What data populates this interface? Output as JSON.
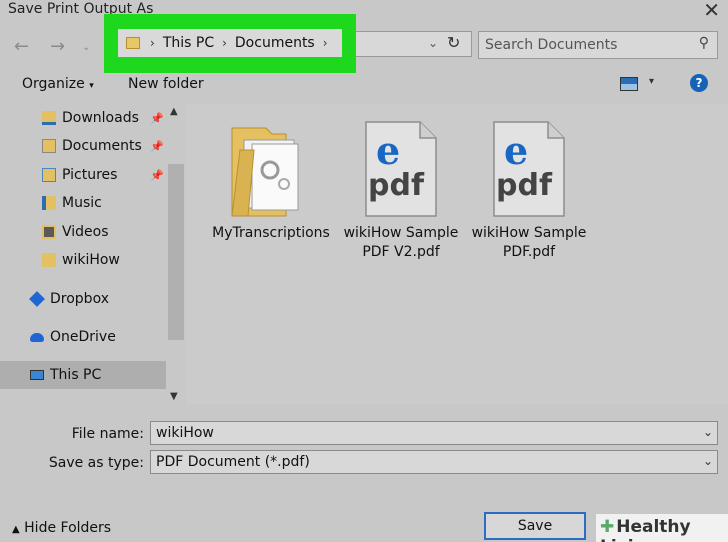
{
  "window": {
    "title": "Save Print Output As",
    "close_icon": "close-icon"
  },
  "nav": {
    "back_icon": "arrow-left-icon",
    "forward_icon": "arrow-right-icon",
    "breadcrumb": [
      "This PC",
      "Documents"
    ],
    "refresh_icon": "refresh-icon",
    "search_placeholder": "Search Documents"
  },
  "toolbar": {
    "organize_label": "Organize",
    "new_folder_label": "New folder",
    "help_label": "?"
  },
  "sidebar": {
    "items": [
      {
        "label": "Downloads",
        "pinned": true
      },
      {
        "label": "Documents",
        "pinned": true
      },
      {
        "label": "Pictures",
        "pinned": true
      },
      {
        "label": "Music",
        "pinned": false
      },
      {
        "label": "Videos",
        "pinned": false
      },
      {
        "label": "wikiHow",
        "pinned": false
      },
      {
        "label": "Dropbox",
        "pinned": false
      },
      {
        "label": "OneDrive",
        "pinned": false
      },
      {
        "label": "This PC",
        "pinned": false,
        "selected": true
      }
    ]
  },
  "files": [
    {
      "name_line1": "MyTranscriptions",
      "name_line2": "",
      "type": "folder"
    },
    {
      "name_line1": "wikiHow Sample",
      "name_line2": "PDF V2.pdf",
      "type": "pdf",
      "icon_text": "pdf"
    },
    {
      "name_line1": "wikiHow Sample",
      "name_line2": "PDF.pdf",
      "type": "pdf",
      "icon_text": "pdf"
    }
  ],
  "form": {
    "file_name_label": "File name:",
    "file_name_value": "wikiHow",
    "save_type_label": "Save as type:",
    "save_type_value": "PDF Document (*.pdf)"
  },
  "footer": {
    "hide_folders_label": "Hide Folders",
    "save_label": "Save"
  },
  "watermark": {
    "text": "Healthy Living"
  },
  "colors": {
    "highlight": "#1dd81d",
    "accent": "#2c6dc2",
    "edge_blue": "#1a67c3"
  }
}
